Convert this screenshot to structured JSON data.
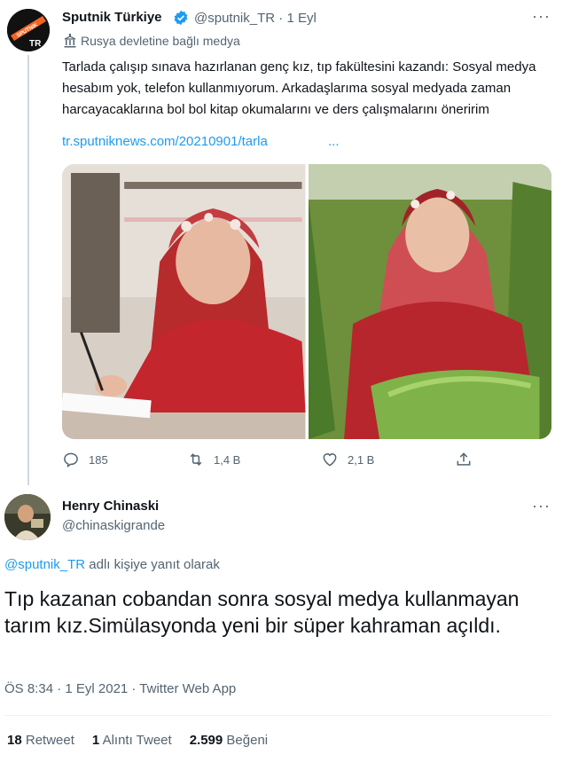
{
  "parent_tweet": {
    "avatar_text": "SPUTNIK",
    "avatar_sub": "TR",
    "display_name": "Sputnik Türkiye",
    "handle": "@sputnik_TR",
    "separator": "·",
    "date": "1 Eyl",
    "state_label": "Rusya devletine bağlı medya",
    "text": "Tarlada çalışıp sınava hazırlanan genç kız, tıp fakültesini kazandı: Sosyal medya hesabım yok, telefon kullanmıyorum. Arkadaşlarıma sosyal medyada zaman harcayacaklarına bol bol kitap okumalarını ve ders çalışmalarını öneririm",
    "link": "tr.sputniknews.com/20210901/tarla",
    "link_ellipsis": "...",
    "replies": "185",
    "retweets": "1,4 B",
    "likes": "2,1 B",
    "icons": [
      "verified-badge-icon",
      "government-building-icon",
      "reply-icon",
      "retweet-icon",
      "like-icon",
      "share-icon",
      "more-icon"
    ]
  },
  "reply_tweet": {
    "display_name": "Henry Chinaski",
    "handle": "@chinaskigrande",
    "reply_to_mention": "@sputnik_TR",
    "reply_to_suffix": " adlı kişiye yanıt olarak",
    "text": "Tıp kazanan cobandan sonra sosyal medya kullanmayan tarım kız.Simülasyonda yeni bir süper kahraman açıldı.",
    "meta": "ÖS 8:34 · 1 Eyl 2021 · Twitter Web App",
    "retweet_count": "18",
    "retweet_label": "Retweet",
    "quote_count": "1",
    "quote_label": "Alıntı Tweet",
    "like_count": "2.599",
    "like_label": "Beğeni"
  },
  "colors": {
    "link": "#1d9bf0",
    "secondary": "#536471",
    "verified": "#1d9bf0",
    "avatar_badge": "#f26522"
  }
}
